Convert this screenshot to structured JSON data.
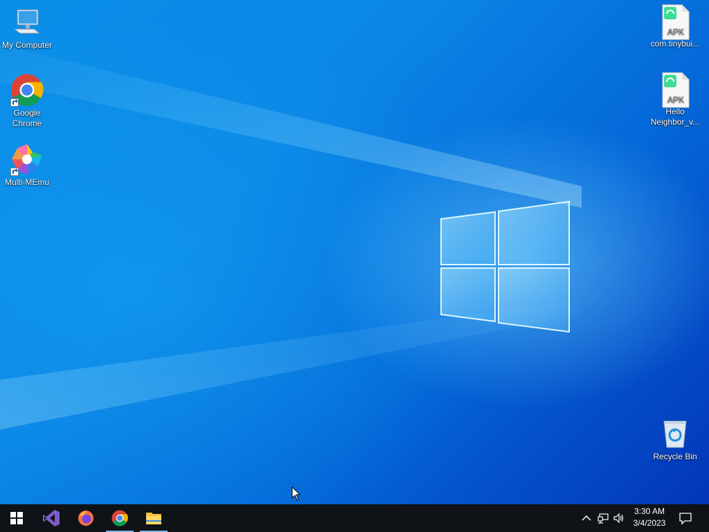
{
  "desktop": {
    "icons_left": [
      {
        "label": "My Computer",
        "icon": "computer-icon"
      },
      {
        "label": "Google Chrome",
        "icon": "chrome-icon",
        "shortcut": true
      },
      {
        "label": "Multi-MEmu",
        "icon": "memu-icon",
        "shortcut": true
      }
    ],
    "icons_right": [
      {
        "label": "com.tinybui...",
        "icon": "apk-file-icon",
        "badge": "APK"
      },
      {
        "label": "Hello Neighbor_v...",
        "icon": "apk-file-icon",
        "badge": "APK"
      },
      {
        "label": "Recycle Bin",
        "icon": "recycle-bin-icon"
      }
    ],
    "colors": {
      "accent": "#0b86e6",
      "deep": "#0335b8",
      "glow": "#7fd8ff"
    }
  },
  "taskbar": {
    "pinned": [
      {
        "name": "start",
        "icon": "windows-start-icon"
      },
      {
        "name": "visual-studio",
        "icon": "visual-studio-icon"
      },
      {
        "name": "firefox",
        "icon": "firefox-icon"
      },
      {
        "name": "chrome",
        "icon": "chrome-icon",
        "active": true
      },
      {
        "name": "file-explorer",
        "icon": "folder-icon",
        "active": true
      }
    ],
    "tray": {
      "icons": [
        "chevron-up-icon",
        "network-icon",
        "volume-icon"
      ],
      "time": "3:30 AM",
      "date": "3/4/2023",
      "notification_icon": "action-center-icon"
    },
    "colors": {
      "background": "#0f1216",
      "active_underline": "#7fb7e8"
    }
  }
}
